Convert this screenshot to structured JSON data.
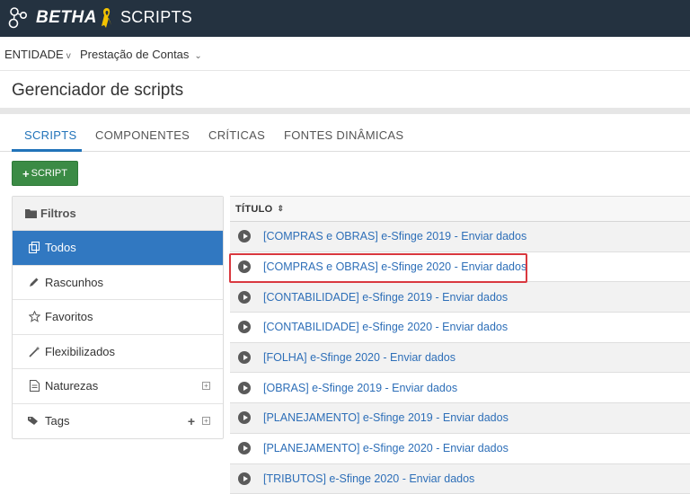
{
  "topbar": {
    "brand": "BETHA",
    "app_title": "SCRIPTS",
    "logo_icon": "hexagon-network-icon",
    "ribbon_icon": "awareness-ribbon-icon",
    "bg_color": "#243240"
  },
  "entitybar": {
    "entity_label": "ENTIDADE",
    "entity_caret": "v",
    "context_label": "Prestação de Contas",
    "context_caret": "⌄"
  },
  "page": {
    "title": "Gerenciador de scripts"
  },
  "tabs": [
    {
      "label": "SCRIPTS",
      "active": true
    },
    {
      "label": "COMPONENTES",
      "active": false
    },
    {
      "label": "CRÍTICAS",
      "active": false
    },
    {
      "label": "FONTES DINÂMICAS",
      "active": false
    }
  ],
  "add_button": {
    "plus": "+",
    "label": "SCRIPT",
    "color": "#3b8b45"
  },
  "sidebar": {
    "header": "Filtros",
    "header_icon": "folder-icon",
    "items": [
      {
        "label": "Todos",
        "icon": "copy-icon",
        "active": true
      },
      {
        "label": "Rascunhos",
        "icon": "pencil-icon",
        "active": false
      },
      {
        "label": "Favoritos",
        "icon": "star-icon",
        "active": false
      },
      {
        "label": "Flexibilizados",
        "icon": "magic-wand-icon",
        "active": false
      },
      {
        "label": "Naturezas",
        "icon": "document-icon",
        "active": false
      },
      {
        "label": "Tags",
        "icon": "tags-icon",
        "active": false
      }
    ],
    "add_symbol": "+",
    "expand_symbol": "+",
    "active_color": "#3178c1"
  },
  "table": {
    "header": "TÍTULO",
    "sort_symbol": "⇕",
    "rows": [
      "[COMPRAS e OBRAS] e-Sfinge 2019 - Enviar dados",
      "[COMPRAS e OBRAS] e-Sfinge 2020 - Enviar dados",
      "[CONTABILIDADE] e-Sfinge 2019 - Enviar dados",
      "[CONTABILIDADE] e-Sfinge 2020 - Enviar dados",
      "[FOLHA] e-Sfinge 2020 - Enviar dados",
      "[OBRAS] e-Sfinge 2019 - Enviar dados",
      "[PLANEJAMENTO] e-Sfinge 2019 - Enviar dados",
      "[PLANEJAMENTO] e-Sfinge 2020 - Enviar dados",
      "[TRIBUTOS] e-Sfinge 2020 - Enviar dados"
    ],
    "highlighted_row_index": 1,
    "highlight_color": "#d9383f",
    "link_color": "#2e6fb8"
  }
}
